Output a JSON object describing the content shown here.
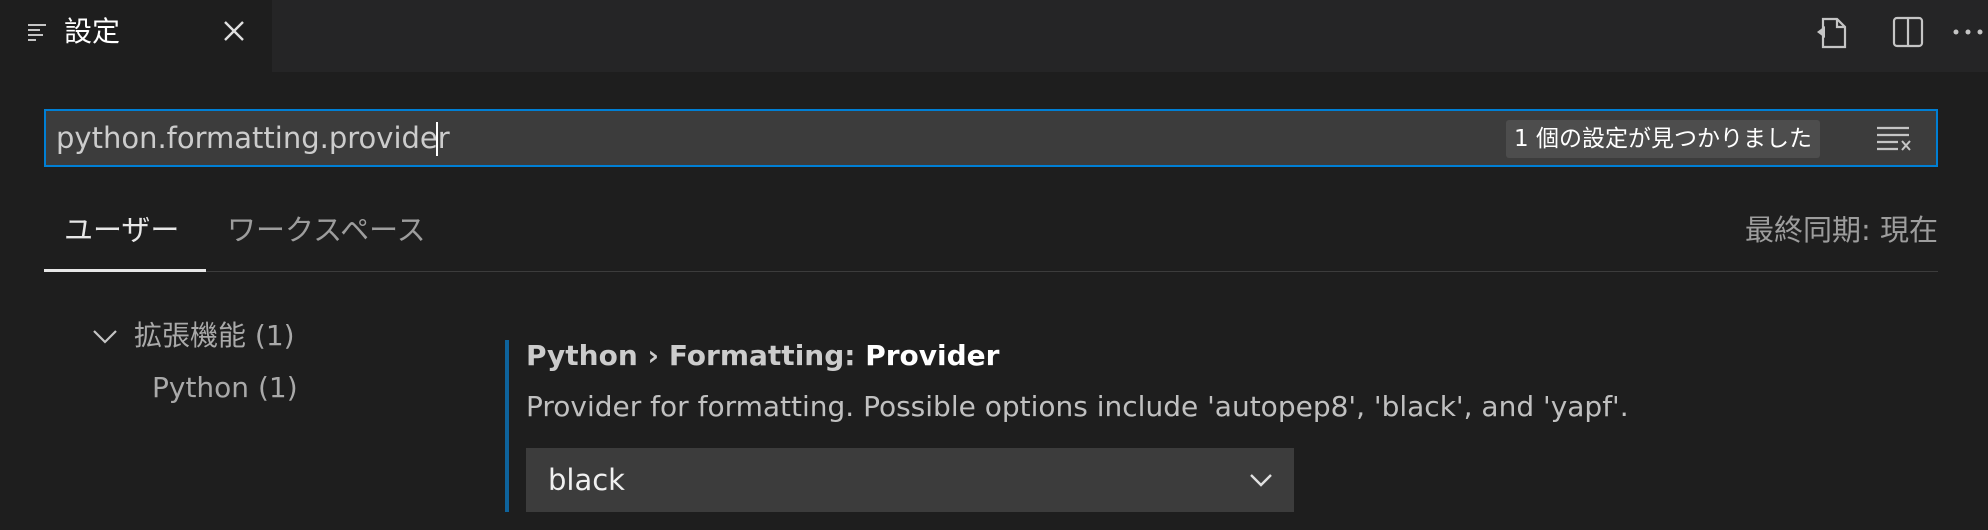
{
  "tab": {
    "icon": "settings-editor-icon",
    "label": "設定",
    "close_icon": "close-icon"
  },
  "editor_actions": [
    {
      "name": "open-settings-json-icon"
    },
    {
      "name": "split-editor-icon"
    },
    {
      "name": "more-actions-icon"
    }
  ],
  "search": {
    "value": "python.formatting.provider",
    "placeholder": "",
    "result_count": "1 個の設定が見つかりました",
    "clear_icon": "clear-filter-icon"
  },
  "scope_tabs": [
    {
      "label": "ユーザー",
      "active": true
    },
    {
      "label": "ワークスペース",
      "active": false
    }
  ],
  "sync_status": "最終同期: 現在",
  "toc": {
    "group_label": "拡張機能 (1)",
    "expanded": true,
    "items": [
      {
        "label": "Python (1)"
      }
    ]
  },
  "setting": {
    "category": "Python › Formatting: ",
    "name": "Provider",
    "description": "Provider for formatting. Possible options include 'autopep8', 'black', and 'yapf'.",
    "selected_value": "black"
  },
  "colors": {
    "focus_border": "#007fd4",
    "modified_indicator": "#0e639c",
    "background": "#1e1e1e"
  }
}
